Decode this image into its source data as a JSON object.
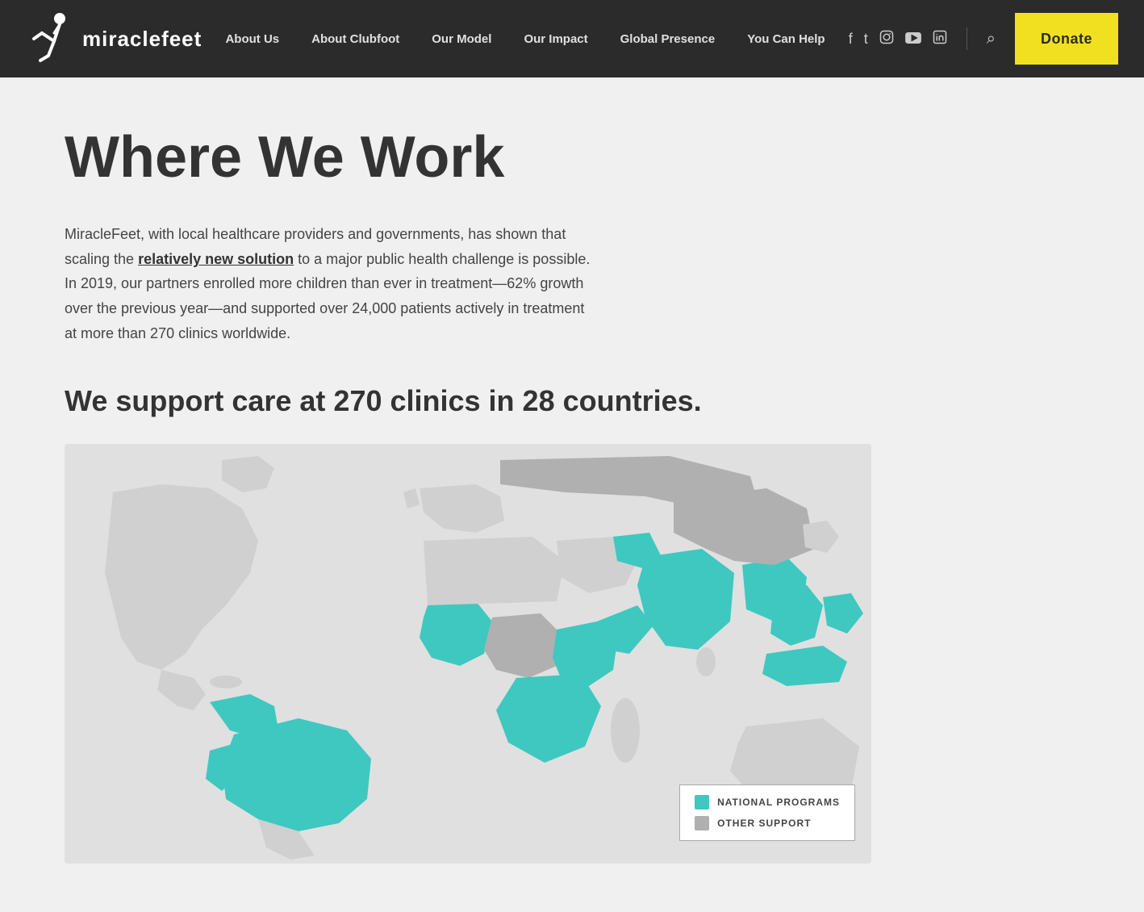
{
  "header": {
    "logo_text": "miraclefeet",
    "nav_items": [
      {
        "label": "About Us",
        "href": "#"
      },
      {
        "label": "About Clubfoot",
        "href": "#"
      },
      {
        "label": "Our Model",
        "href": "#"
      },
      {
        "label": "Our Impact",
        "href": "#"
      },
      {
        "label": "Global Presence",
        "href": "#"
      },
      {
        "label": "You Can Help",
        "href": "#"
      }
    ],
    "donate_label": "Donate"
  },
  "page": {
    "title": "Where We Work",
    "description_part1": "MiracleFeet, with local healthcare providers and governments, has shown that scaling the ",
    "description_link": "relatively new solution",
    "description_part2": " to a major public health challenge is possible. In 2019, our partners enrolled more children than ever in treatment—62% growth over the previous year—and supported over 24,000 patients actively in treatment at more than 270 clinics worldwide.",
    "clinics_heading": "We support care at 270 clinics in 28 countries.",
    "legend_national": "NATIONAL PROGRAMS",
    "legend_other": "OTHER SUPPORT"
  }
}
